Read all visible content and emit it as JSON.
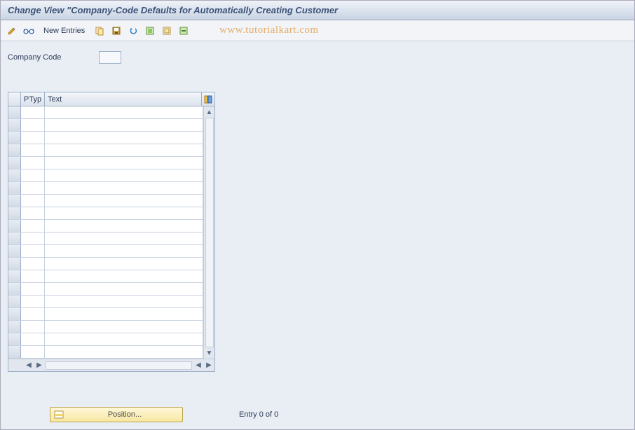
{
  "title": "Change View \"Company-Code Defaults for Automatically Creating Customer",
  "watermark": "www.tutorialkart.com",
  "toolbar": {
    "new_entries": "New Entries"
  },
  "form": {
    "company_code_label": "Company Code",
    "company_code_value": ""
  },
  "table": {
    "columns": {
      "ptyp": "PTyp",
      "text": "Text"
    },
    "rows": [
      {
        "ptyp": "",
        "text": ""
      },
      {
        "ptyp": "",
        "text": ""
      },
      {
        "ptyp": "",
        "text": ""
      },
      {
        "ptyp": "",
        "text": ""
      },
      {
        "ptyp": "",
        "text": ""
      },
      {
        "ptyp": "",
        "text": ""
      },
      {
        "ptyp": "",
        "text": ""
      },
      {
        "ptyp": "",
        "text": ""
      },
      {
        "ptyp": "",
        "text": ""
      },
      {
        "ptyp": "",
        "text": ""
      },
      {
        "ptyp": "",
        "text": ""
      },
      {
        "ptyp": "",
        "text": ""
      },
      {
        "ptyp": "",
        "text": ""
      },
      {
        "ptyp": "",
        "text": ""
      },
      {
        "ptyp": "",
        "text": ""
      },
      {
        "ptyp": "",
        "text": ""
      },
      {
        "ptyp": "",
        "text": ""
      },
      {
        "ptyp": "",
        "text": ""
      },
      {
        "ptyp": "",
        "text": ""
      },
      {
        "ptyp": "",
        "text": ""
      }
    ]
  },
  "footer": {
    "position_label": "Position...",
    "status": "Entry 0 of 0"
  }
}
